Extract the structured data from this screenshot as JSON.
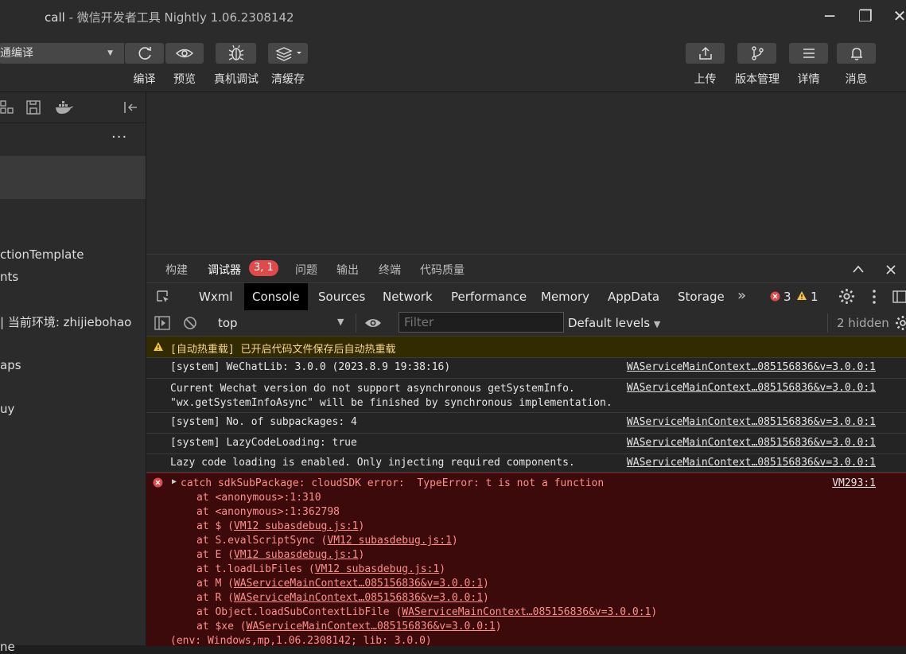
{
  "window": {
    "project": "call",
    "title": "- 微信开发者工具 Nightly 1.06.2308142",
    "minimize_glyph": "─",
    "maximize_glyph": "❐",
    "close_glyph": "✕"
  },
  "toolbar": {
    "compile_mode": "通编译",
    "compile_label": "编译",
    "preview_label": "预览",
    "realdevice_label": "真机调试",
    "clearcache_label": "清缓存",
    "upload_label": "上传",
    "version_label": "版本管理",
    "details_label": "详情",
    "messages_label": "消息"
  },
  "sidebar": {
    "more": "···",
    "lines": [
      "ctionTemplate",
      "nts",
      "| 当前环境: zhijiebohao",
      "aps",
      "uy",
      "ne"
    ]
  },
  "debug_tabs": {
    "build": "构建",
    "debugger": "调试器",
    "debugger_badge": "3, 1",
    "issues": "问题",
    "output": "输出",
    "terminal": "终端",
    "quality": "代码质量"
  },
  "devtools_tabs": [
    "Wxml",
    "Console",
    "Sources",
    "Network",
    "Performance",
    "Memory",
    "AppData",
    "Storage"
  ],
  "devtools_status": {
    "more": "»",
    "errors": "3",
    "warnings": "1"
  },
  "console_filter": {
    "context": "top",
    "placeholder": "Filter",
    "levels": "Default levels",
    "hidden": "2 hidden"
  },
  "console": {
    "warn_message": "[自动热重载] 已开启代码文件保存后自动热重载",
    "rows": [
      {
        "msg": "[system] WeChatLib: 3.0.0 (2023.8.9 19:38:16)",
        "src": "WAServiceMainContext…085156836&v=3.0.0:1"
      },
      {
        "msg": "Current Wechat version do not support asynchronous getSystemInfo.\n\"wx.getSystemInfoAsync\" will be finished by synchronous implementation.",
        "src": "WAServiceMainContext…085156836&v=3.0.0:1"
      },
      {
        "msg": "[system] No. of subpackages: 4",
        "src": "WAServiceMainContext…085156836&v=3.0.0:1"
      },
      {
        "msg": "[system] LazyCodeLoading: true",
        "src": "WAServiceMainContext…085156836&v=3.0.0:1"
      },
      {
        "msg": "Lazy code loading is enabled. Only injecting required components.",
        "src": "WAServiceMainContext…085156836&v=3.0.0:1"
      }
    ],
    "error": {
      "message": "catch sdkSubPackage: cloudSDK error:  TypeError: t is not a function",
      "src": "VM293:1",
      "stack": [
        {
          "pre": "at <anonymous>:1:310",
          "link": "",
          "post": ""
        },
        {
          "pre": "at <anonymous>:1:362798",
          "link": "",
          "post": ""
        },
        {
          "pre": "at $ (",
          "link": "VM12 subasdebug.js:1",
          "post": ")"
        },
        {
          "pre": "at S.evalScriptSync (",
          "link": "VM12 subasdebug.js:1",
          "post": ")"
        },
        {
          "pre": "at E (",
          "link": "VM12 subasdebug.js:1",
          "post": ")"
        },
        {
          "pre": "at t.loadLibFiles (",
          "link": "VM12 subasdebug.js:1",
          "post": ")"
        },
        {
          "pre": "at M (",
          "link": "WAServiceMainContext…085156836&v=3.0.0:1",
          "post": ")"
        },
        {
          "pre": "at R (",
          "link": "WAServiceMainContext…085156836&v=3.0.0:1",
          "post": ")"
        },
        {
          "pre": "at Object.loadSubContextLibFile (",
          "link": "WAServiceMainContext…085156836&v=3.0.0:1",
          "post": ")"
        },
        {
          "pre": "at $xe (",
          "link": "WAServiceMainContext…085156836&v=3.0.0:1",
          "post": ")"
        }
      ],
      "env": "(env: Windows,mp,1.06.2308142; lib: 3.0.0)"
    }
  }
}
